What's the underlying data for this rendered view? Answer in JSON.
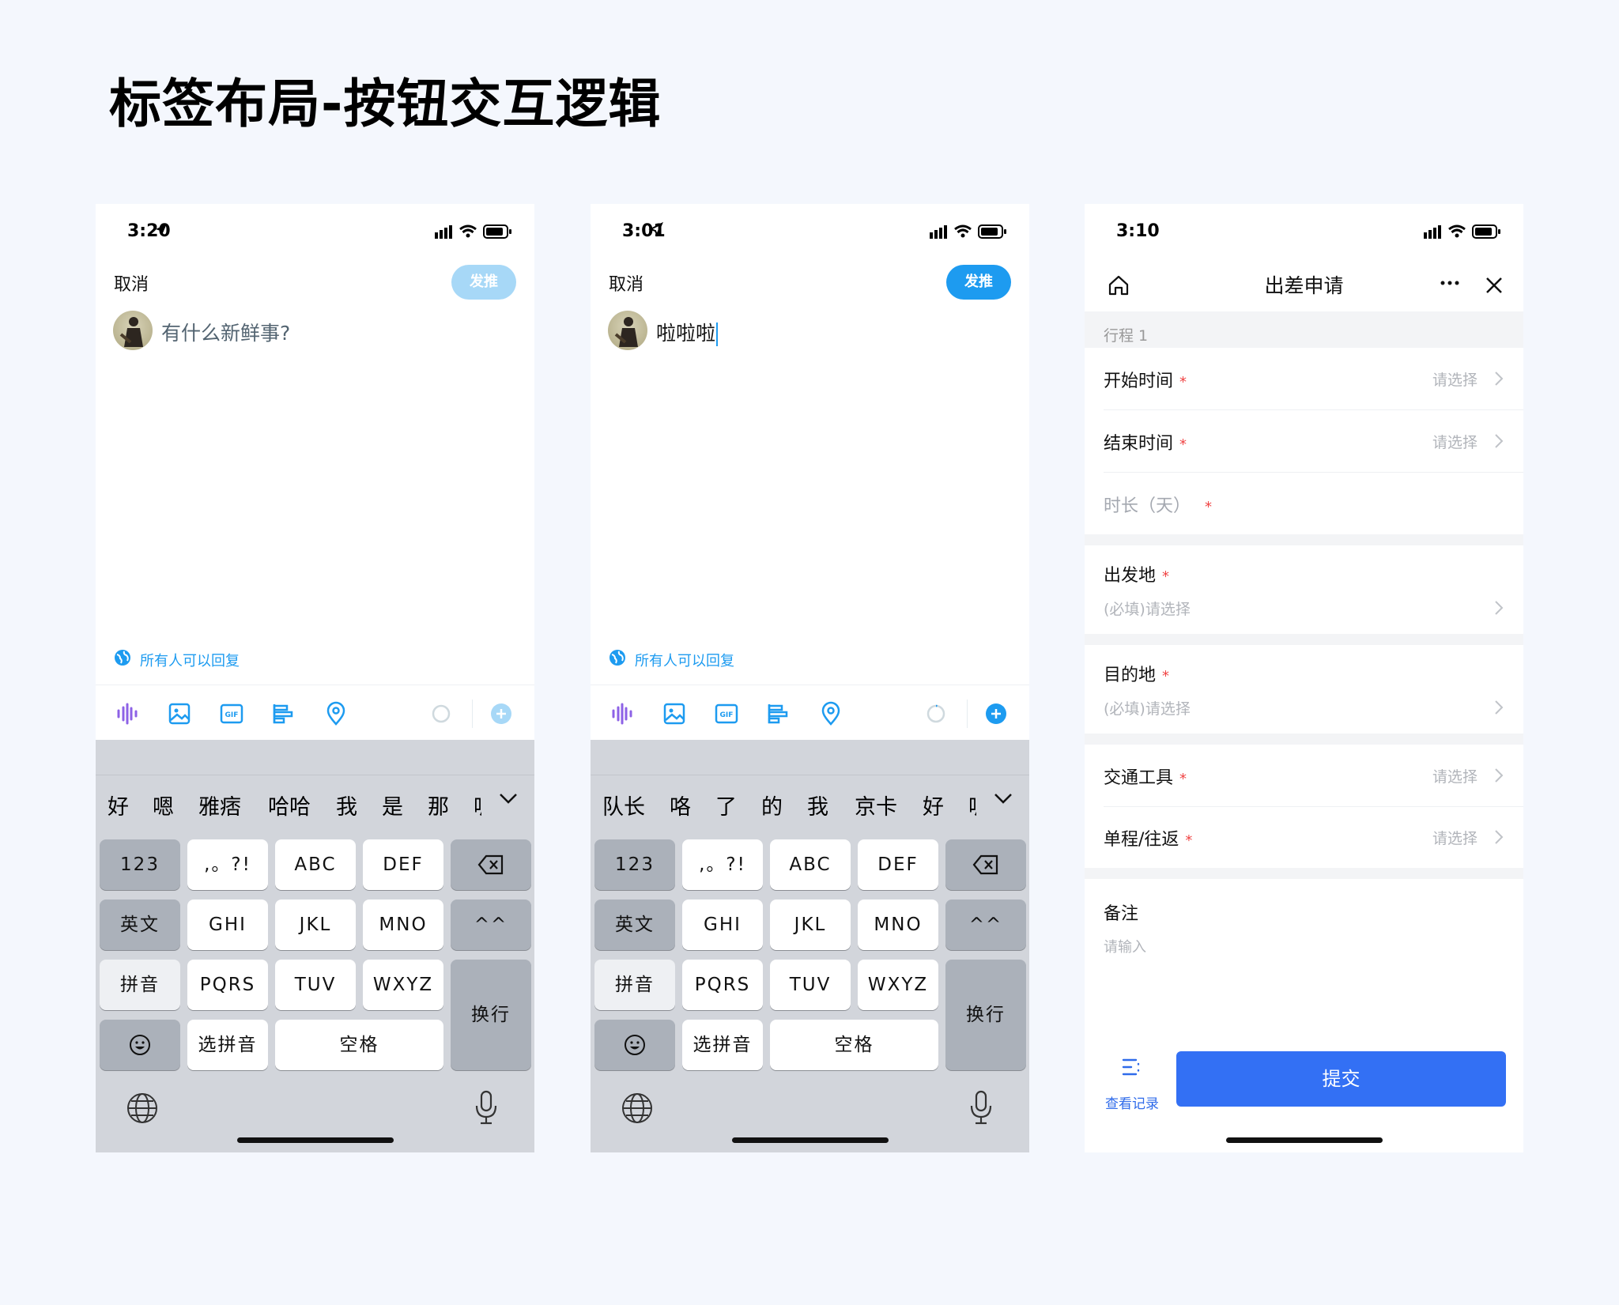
{
  "page": {
    "title": "标签布局-按钮交互逻辑"
  },
  "screen1": {
    "time": "3:20",
    "cancel": "取消",
    "tweet_button": "发推",
    "compose_placeholder": "有什么新鲜事?",
    "reply_setting": "所有人可以回复",
    "candidates": [
      "好",
      "嗯",
      "雅痞",
      "哈哈",
      "我",
      "是",
      "那",
      "呃"
    ]
  },
  "screen2": {
    "time": "3:01",
    "cancel": "取消",
    "tweet_button": "发推",
    "compose_text": "啦啦啦",
    "reply_setting": "所有人可以回复",
    "candidates": [
      "队长",
      "咯",
      "了",
      "的",
      "我",
      "京卡",
      "好",
      "呃"
    ]
  },
  "keyboard": {
    "row1": [
      "123",
      ",。?!",
      "ABC",
      "DEF"
    ],
    "row2": [
      "英文",
      "GHI",
      "JKL",
      "MNO",
      "^^"
    ],
    "row3": [
      "拼音",
      "PQRS",
      "TUV",
      "WXYZ"
    ],
    "row4": [
      "选拼音",
      "空格"
    ],
    "return": "换行"
  },
  "screen3": {
    "time": "3:10",
    "nav_title": "出差申请",
    "trip_section": "行程 1",
    "start_time": {
      "label": "开始时间",
      "value": "请选择"
    },
    "end_time": {
      "label": "结束时间",
      "value": "请选择"
    },
    "duration": {
      "label": "时长（天）"
    },
    "departure": {
      "label": "出发地",
      "placeholder": "(必填)请选择"
    },
    "destination": {
      "label": "目的地",
      "placeholder": "(必填)请选择"
    },
    "transport": {
      "label": "交通工具",
      "value": "请选择"
    },
    "trip_type": {
      "label": "单程/往返",
      "value": "请选择"
    },
    "remark": {
      "label": "备注",
      "placeholder": "请输入"
    },
    "records_label": "查看记录",
    "submit": "提交",
    "required_mark": "*"
  },
  "colors": {
    "twitter_blue": "#1d9bf0",
    "twitter_blue_disabled": "#a7d8f7",
    "submit_blue": "#3370f4",
    "required_red": "#f04444",
    "keyboard_bg": "#d2d5db"
  }
}
